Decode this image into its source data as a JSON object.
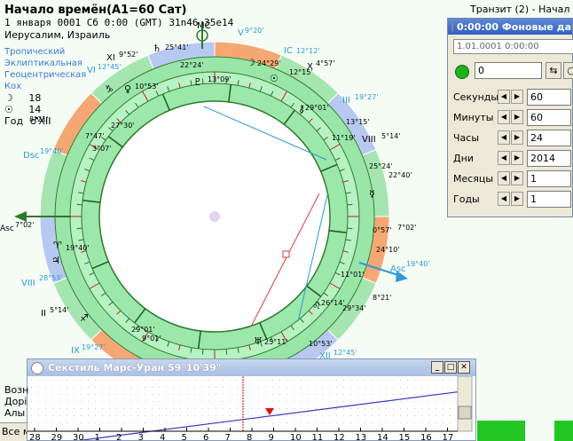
{
  "header": {
    "title": "Начало времён(A1=60 Сат)",
    "line1": "1 января 0001  Сб   0:00 (GMT) 31n46  35e14",
    "line2": "Иерусалим, Израиль",
    "zodiac": "Тропический",
    "ecliptic": "Эклиптикальная",
    "geo": "Геоцентрическая",
    "house_system": "Кох",
    "moon_label": "18",
    "sun_label": "14",
    "year_label": "Год",
    "year_planet": "XII"
  },
  "transit_label": "Транзит (2) - Начал",
  "panel": {
    "title": "0:00:00 Фоновые дан",
    "date_value": "1.01.0001   0:00:00",
    "counter_value": "0",
    "rows": [
      {
        "label": "Секунды",
        "value": "60"
      },
      {
        "label": "Минуты",
        "value": "60"
      },
      {
        "label": "Часы",
        "value": "24"
      },
      {
        "label": "Дни",
        "value": "2014"
      },
      {
        "label": "Месяцы",
        "value": "1"
      },
      {
        "label": "Годы",
        "value": "1"
      }
    ]
  },
  "bottom_window": {
    "title": "Секстиль Марс-Уран  59°10'39\"",
    "axis_labels": [
      "28",
      "29",
      "30",
      "1",
      "2",
      "3",
      "4",
      "5",
      "6",
      "7",
      "8",
      "9",
      "10",
      "11",
      "12",
      "13",
      "14",
      "15",
      "16",
      "17"
    ],
    "left_labels": [
      "Возн",
      "Дорі",
      "Алы"
    ],
    "status": "Все м"
  },
  "chart_labels": {
    "asc_left": "Asc",
    "asc_left_deg": "7°02'",
    "dsc_left": "Dsc",
    "dsc_left_deg": "19°40'",
    "asc_right": "Asc",
    "asc_right_deg": "19°40'",
    "mc": "MC",
    "ic": "IC",
    "deg_ic": "12°12'",
    "deg_v": "9°20'",
    "deg_xi": "9°52'",
    "deg_vi": "12°45'",
    "deg_iii": "19°27'",
    "deg_viii": "5°14'",
    "deg_ii": "5°14'",
    "deg_ix": "19°27'",
    "deg_xii": "12°45'",
    "deg_x": "4°57'",
    "deg_25_41": "25°41'",
    "deg_22_24": "22°24'",
    "deg_24_29": "24°29'",
    "deg_12_15": "12°15'",
    "deg_13_09": "13°09'",
    "deg_29_01": "29°01'",
    "deg_13_15": "13°15'",
    "deg_11_19": "11°19'",
    "deg_10_53": "10°53'",
    "deg_27_30": "27°30'",
    "deg_7_47": "7°47'",
    "deg_3_07": "3°07'",
    "deg_19_40": "19°40'",
    "deg_28_53": "28°53'",
    "deg_25_24": "25°24'",
    "deg_22_40": "22°40'",
    "deg_0_57": "0°57'",
    "deg_24_10": "24°10'",
    "deg_11_01": "11°01'",
    "deg_8_21": "8°21'",
    "deg_26_14": "26°14'",
    "deg_29_34": "29°34'",
    "deg_29_01b": "29°01'",
    "deg_9_01": "9°01'",
    "deg_25_11": "25°11'",
    "deg_10_53b": "10°53'",
    "deg_8_21b": "8°21'",
    "asc_7_02": "7°02'"
  }
}
